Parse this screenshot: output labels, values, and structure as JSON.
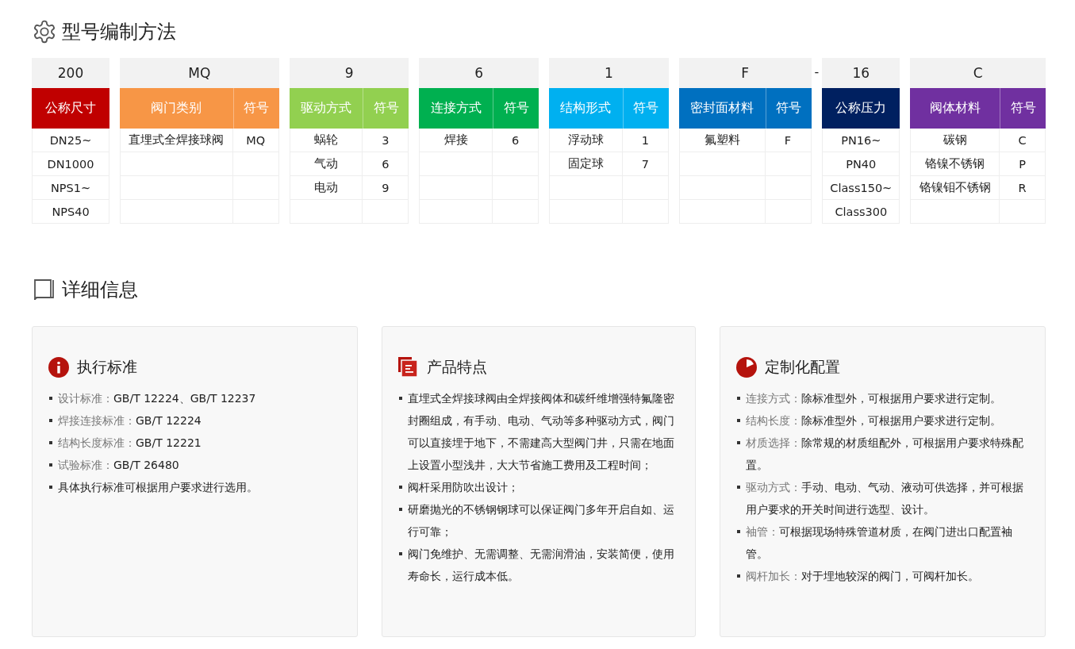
{
  "coding_section": {
    "title": "型号编制方法"
  },
  "code_groups": [
    {
      "kind": "group",
      "code": "200",
      "color": "#c00000",
      "columns": [
        "公称尺寸"
      ],
      "rows": [
        [
          "DN25~"
        ],
        [
          "DN1000"
        ],
        [
          "NPS1~"
        ],
        [
          "NPS40"
        ]
      ]
    },
    {
      "kind": "group",
      "code": "MQ",
      "color": "#f79646",
      "columns": [
        "阀门类别",
        "符号"
      ],
      "rows": [
        [
          "直埋式全焊接球阀",
          "MQ"
        ]
      ]
    },
    {
      "kind": "group",
      "code": "9",
      "color": "#92d050",
      "columns": [
        "驱动方式",
        "符号"
      ],
      "rows": [
        [
          "蜗轮",
          "3"
        ],
        [
          "气动",
          "6"
        ],
        [
          "电动",
          "9"
        ]
      ]
    },
    {
      "kind": "group",
      "code": "6",
      "color": "#00b050",
      "columns": [
        "连接方式",
        "符号"
      ],
      "rows": [
        [
          "焊接",
          "6"
        ]
      ]
    },
    {
      "kind": "group",
      "code": "1",
      "color": "#00b0f0",
      "columns": [
        "结构形式",
        "符号"
      ],
      "rows": [
        [
          "浮动球",
          "1"
        ],
        [
          "固定球",
          "7"
        ]
      ]
    },
    {
      "kind": "group",
      "code": "F",
      "color": "#0070c0",
      "columns": [
        "密封面材料",
        "符号"
      ],
      "rows": [
        [
          "氟塑料",
          "F"
        ]
      ]
    },
    {
      "kind": "separator",
      "text": "-"
    },
    {
      "kind": "group",
      "code": "16",
      "color": "#002060",
      "columns": [
        "公称压力"
      ],
      "rows": [
        [
          "PN16~"
        ],
        [
          "PN40"
        ],
        [
          "Class150~"
        ],
        [
          "Class300"
        ]
      ]
    },
    {
      "kind": "group",
      "code": "C",
      "color": "#7030a0",
      "columns": [
        "阀体材料",
        "符号"
      ],
      "rows": [
        [
          "碳钢",
          "C"
        ],
        [
          "铬镍不锈钢",
          "P"
        ],
        [
          "铬镍钼不锈钢",
          "R"
        ]
      ]
    }
  ],
  "detail_section": {
    "title": "详细信息"
  },
  "cards": [
    {
      "title": "执行标准",
      "items": [
        {
          "label": "设计标准：",
          "text": "GB/T 12224、GB/T 12237"
        },
        {
          "label": "焊接连接标准：",
          "text": "GB/T 12224"
        },
        {
          "label": "结构长度标准：",
          "text": "GB/T 12221"
        },
        {
          "label": "试验标准：",
          "text": "GB/T 26480"
        },
        {
          "text": "具体执行标准可根据用户要求进行选用。"
        }
      ]
    },
    {
      "title": "产品特点",
      "items": [
        {
          "text": "直埋式全焊接球阀由全焊接阀体和碳纤维增强特氟隆密封圈组成，有手动、电动、气动等多种驱动方式，阀门可以直接埋于地下，不需建高大型阀门井，只需在地面上设置小型浅井，大大节省施工费用及工程时间；"
        },
        {
          "text": "阀杆采用防吹出设计；"
        },
        {
          "text": "研磨抛光的不锈钢钢球可以保证阀门多年开启自如、运行可靠；"
        },
        {
          "text": "阀门免维护、无需调整、无需润滑油，安装简便，使用寿命长，运行成本低。"
        }
      ]
    },
    {
      "title": "定制化配置",
      "items": [
        {
          "label": "连接方式：",
          "text": "除标准型外，可根据用户要求进行定制。"
        },
        {
          "label": "结构长度：",
          "text": "除标准型外，可根据用户要求进行定制。"
        },
        {
          "label": "材质选择：",
          "text": "除常规的材质组配外，可根据用户要求特殊配置。"
        },
        {
          "label": "驱动方式：",
          "text": "手动、电动、气动、液动可供选择，并可根据用户要求的开关时间进行选型、设计。"
        },
        {
          "label": "袖管：",
          "text": "可根据现场特殊管道材质，在阀门进出口配置袖管。"
        },
        {
          "label": "阀杆加长：",
          "text": "对于埋地较深的阀门，可阀杆加长。"
        }
      ]
    }
  ]
}
